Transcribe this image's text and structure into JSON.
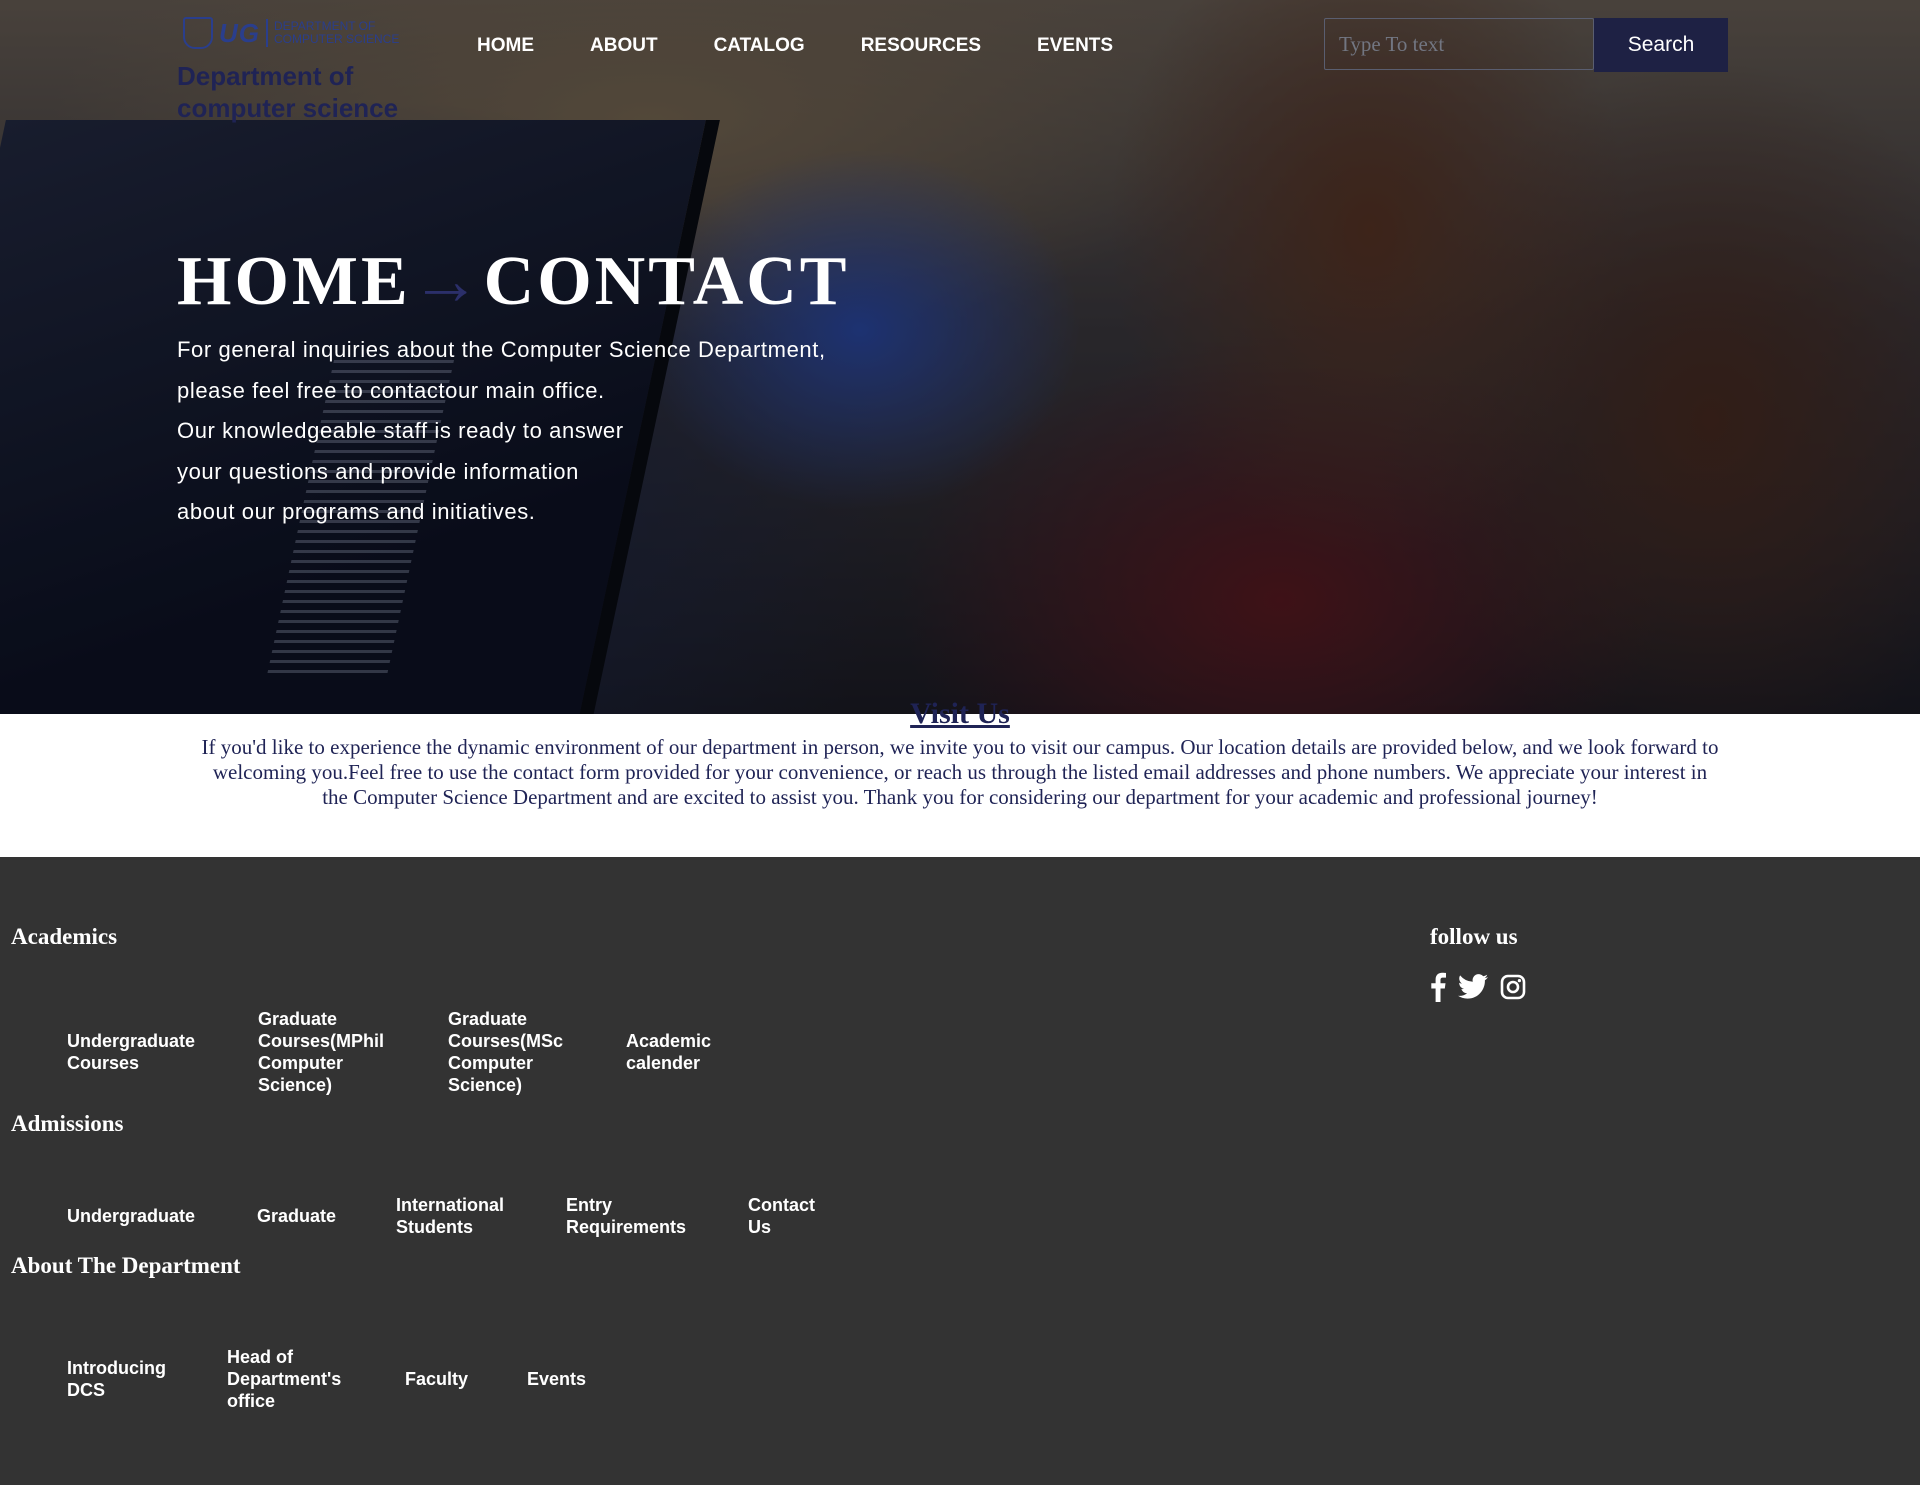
{
  "header": {
    "logo_text": "UG",
    "logo_subtitle_line1": "DEPARTMENT OF",
    "logo_subtitle_line2": "COMPUTER SCIENCE",
    "dept_name": "Department of computer science",
    "nav": [
      "HOME",
      "ABOUT",
      "CATALOG",
      "RESOURCES",
      "EVENTS"
    ],
    "search_placeholder": "Type To text",
    "search_button": "Search"
  },
  "hero": {
    "title_left": "HOME",
    "title_arrow": "→",
    "title_right": "CONTACT",
    "lines": [
      "For general inquiries about the Computer Science Department,",
      "please feel free to contactour main office.",
      "Our knowledgeable staff is ready to answer",
      "your questions and provide information",
      "about our programs and initiatives."
    ]
  },
  "visit": {
    "title": "Visit Us",
    "text": "If you'd like to experience the dynamic environment of our department in person, we invite you to visit our campus. Our location details are provided below, and we look forward to welcoming you.Feel free to use the contact form provided for your convenience, or reach us through the listed email addresses and phone numbers. We appreciate your interest in the Computer Science Department and are excited to assist you. Thank you for considering our department for your academic and professional journey!"
  },
  "footer": {
    "academics": {
      "heading": "Academics",
      "links": [
        "Undergraduate Courses",
        "Graduate Courses(MPhil Computer Science)",
        "Graduate Courses(MSc Computer Science)",
        "Academic calender"
      ]
    },
    "admissions": {
      "heading": "Admissions",
      "links": [
        "Undergraduate",
        "Graduate",
        "International Students",
        "Entry Requirements",
        "Contact Us"
      ]
    },
    "about": {
      "heading": "About The Department",
      "links": [
        "Introducing DCS",
        "Head of Department's office",
        "Faculty",
        "Events"
      ]
    },
    "follow": {
      "heading": "follow us",
      "icons": [
        "facebook-icon",
        "twitter-icon",
        "instagram-icon"
      ]
    }
  },
  "colors": {
    "brand_navy": "#1f2355",
    "search_button": "#1e2144",
    "footer_bg": "#333333"
  }
}
